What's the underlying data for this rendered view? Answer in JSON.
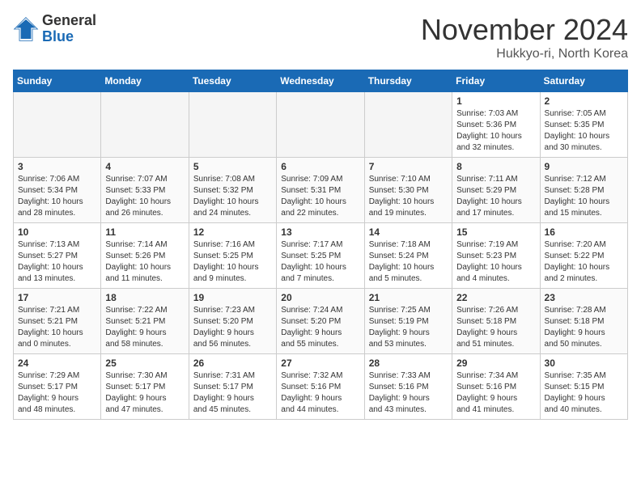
{
  "header": {
    "logo_general": "General",
    "logo_blue": "Blue",
    "month": "November 2024",
    "location": "Hukkyo-ri, North Korea"
  },
  "weekdays": [
    "Sunday",
    "Monday",
    "Tuesday",
    "Wednesday",
    "Thursday",
    "Friday",
    "Saturday"
  ],
  "weeks": [
    [
      {
        "day": "",
        "info": ""
      },
      {
        "day": "",
        "info": ""
      },
      {
        "day": "",
        "info": ""
      },
      {
        "day": "",
        "info": ""
      },
      {
        "day": "",
        "info": ""
      },
      {
        "day": "1",
        "info": "Sunrise: 7:03 AM\nSunset: 5:36 PM\nDaylight: 10 hours\nand 32 minutes."
      },
      {
        "day": "2",
        "info": "Sunrise: 7:05 AM\nSunset: 5:35 PM\nDaylight: 10 hours\nand 30 minutes."
      }
    ],
    [
      {
        "day": "3",
        "info": "Sunrise: 7:06 AM\nSunset: 5:34 PM\nDaylight: 10 hours\nand 28 minutes."
      },
      {
        "day": "4",
        "info": "Sunrise: 7:07 AM\nSunset: 5:33 PM\nDaylight: 10 hours\nand 26 minutes."
      },
      {
        "day": "5",
        "info": "Sunrise: 7:08 AM\nSunset: 5:32 PM\nDaylight: 10 hours\nand 24 minutes."
      },
      {
        "day": "6",
        "info": "Sunrise: 7:09 AM\nSunset: 5:31 PM\nDaylight: 10 hours\nand 22 minutes."
      },
      {
        "day": "7",
        "info": "Sunrise: 7:10 AM\nSunset: 5:30 PM\nDaylight: 10 hours\nand 19 minutes."
      },
      {
        "day": "8",
        "info": "Sunrise: 7:11 AM\nSunset: 5:29 PM\nDaylight: 10 hours\nand 17 minutes."
      },
      {
        "day": "9",
        "info": "Sunrise: 7:12 AM\nSunset: 5:28 PM\nDaylight: 10 hours\nand 15 minutes."
      }
    ],
    [
      {
        "day": "10",
        "info": "Sunrise: 7:13 AM\nSunset: 5:27 PM\nDaylight: 10 hours\nand 13 minutes."
      },
      {
        "day": "11",
        "info": "Sunrise: 7:14 AM\nSunset: 5:26 PM\nDaylight: 10 hours\nand 11 minutes."
      },
      {
        "day": "12",
        "info": "Sunrise: 7:16 AM\nSunset: 5:25 PM\nDaylight: 10 hours\nand 9 minutes."
      },
      {
        "day": "13",
        "info": "Sunrise: 7:17 AM\nSunset: 5:25 PM\nDaylight: 10 hours\nand 7 minutes."
      },
      {
        "day": "14",
        "info": "Sunrise: 7:18 AM\nSunset: 5:24 PM\nDaylight: 10 hours\nand 5 minutes."
      },
      {
        "day": "15",
        "info": "Sunrise: 7:19 AM\nSunset: 5:23 PM\nDaylight: 10 hours\nand 4 minutes."
      },
      {
        "day": "16",
        "info": "Sunrise: 7:20 AM\nSunset: 5:22 PM\nDaylight: 10 hours\nand 2 minutes."
      }
    ],
    [
      {
        "day": "17",
        "info": "Sunrise: 7:21 AM\nSunset: 5:21 PM\nDaylight: 10 hours\nand 0 minutes."
      },
      {
        "day": "18",
        "info": "Sunrise: 7:22 AM\nSunset: 5:21 PM\nDaylight: 9 hours\nand 58 minutes."
      },
      {
        "day": "19",
        "info": "Sunrise: 7:23 AM\nSunset: 5:20 PM\nDaylight: 9 hours\nand 56 minutes."
      },
      {
        "day": "20",
        "info": "Sunrise: 7:24 AM\nSunset: 5:20 PM\nDaylight: 9 hours\nand 55 minutes."
      },
      {
        "day": "21",
        "info": "Sunrise: 7:25 AM\nSunset: 5:19 PM\nDaylight: 9 hours\nand 53 minutes."
      },
      {
        "day": "22",
        "info": "Sunrise: 7:26 AM\nSunset: 5:18 PM\nDaylight: 9 hours\nand 51 minutes."
      },
      {
        "day": "23",
        "info": "Sunrise: 7:28 AM\nSunset: 5:18 PM\nDaylight: 9 hours\nand 50 minutes."
      }
    ],
    [
      {
        "day": "24",
        "info": "Sunrise: 7:29 AM\nSunset: 5:17 PM\nDaylight: 9 hours\nand 48 minutes."
      },
      {
        "day": "25",
        "info": "Sunrise: 7:30 AM\nSunset: 5:17 PM\nDaylight: 9 hours\nand 47 minutes."
      },
      {
        "day": "26",
        "info": "Sunrise: 7:31 AM\nSunset: 5:17 PM\nDaylight: 9 hours\nand 45 minutes."
      },
      {
        "day": "27",
        "info": "Sunrise: 7:32 AM\nSunset: 5:16 PM\nDaylight: 9 hours\nand 44 minutes."
      },
      {
        "day": "28",
        "info": "Sunrise: 7:33 AM\nSunset: 5:16 PM\nDaylight: 9 hours\nand 43 minutes."
      },
      {
        "day": "29",
        "info": "Sunrise: 7:34 AM\nSunset: 5:16 PM\nDaylight: 9 hours\nand 41 minutes."
      },
      {
        "day": "30",
        "info": "Sunrise: 7:35 AM\nSunset: 5:15 PM\nDaylight: 9 hours\nand 40 minutes."
      }
    ]
  ]
}
